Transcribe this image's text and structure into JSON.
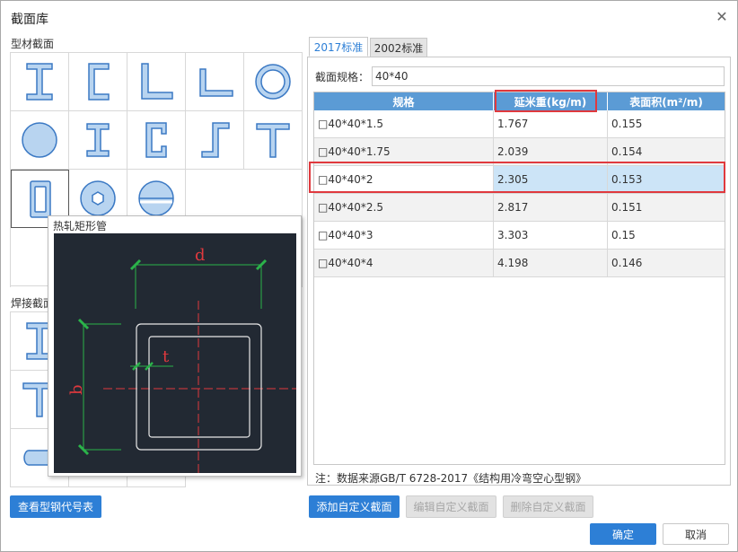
{
  "dialog": {
    "title": "截面库",
    "close_icon": "close-icon"
  },
  "left": {
    "profile_section_label": "型材截面",
    "weld_section_label": "焊接截面",
    "view_codes_button": "查看型钢代号表",
    "profiles": [
      {
        "name": "i-beam-icon"
      },
      {
        "name": "channel-icon"
      },
      {
        "name": "equal-angle-icon"
      },
      {
        "name": "unequal-angle-icon"
      },
      {
        "name": "round-tube-icon"
      },
      {
        "name": "solid-round-icon"
      },
      {
        "name": "h-beam-icon"
      },
      {
        "name": "c-channel-icon"
      },
      {
        "name": "z-section-icon"
      },
      {
        "name": "t-section-icon"
      },
      {
        "name": "rect-tube-icon"
      },
      {
        "name": "hex-bolt-icon"
      },
      {
        "name": "sphere-icon"
      }
    ]
  },
  "tooltip": {
    "title": "热轧矩形管",
    "label_d": "d",
    "label_b": "b",
    "label_t": "t"
  },
  "tabs": [
    {
      "label": "2017标准",
      "active": true
    },
    {
      "label": "2002标准",
      "active": false
    }
  ],
  "spec": {
    "label": "截面规格：",
    "value": "40*40"
  },
  "table": {
    "headers": [
      "规格",
      "延米重(kg/m)",
      "表面积(m²/m)"
    ],
    "rows": [
      {
        "spec": "□40*40*1.5",
        "weight": "1.767",
        "area": "0.155"
      },
      {
        "spec": "□40*40*1.75",
        "weight": "2.039",
        "area": "0.154"
      },
      {
        "spec": "□40*40*2",
        "weight": "2.305",
        "area": "0.153"
      },
      {
        "spec": "□40*40*2.5",
        "weight": "2.817",
        "area": "0.151"
      },
      {
        "spec": "□40*40*3",
        "weight": "3.303",
        "area": "0.15"
      },
      {
        "spec": "□40*40*4",
        "weight": "4.198",
        "area": "0.146"
      }
    ],
    "selected_index": 2
  },
  "note": "注：数据来源GB/T 6728-2017《结构用冷弯空心型钢》",
  "buttons": {
    "add_custom": "添加自定义截面",
    "edit_custom": "编辑自定义截面",
    "delete_custom": "删除自定义截面",
    "ok": "确定",
    "cancel": "取消"
  },
  "colors": {
    "accent": "#2d7fd6",
    "header": "#5b9bd5",
    "highlight": "#e0393e",
    "selected_row": "#cce4f7",
    "icon_fill": "#b8d4f0",
    "icon_stroke": "#3b79c4"
  }
}
